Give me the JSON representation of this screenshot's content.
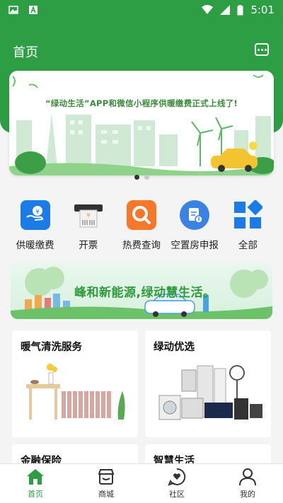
{
  "status_bar": {
    "time": "5:01"
  },
  "header": {
    "title": "首页"
  },
  "banner": {
    "headline": "“绿动生活”APP和微信小程序供暖缴费正式上线了!"
  },
  "services": [
    {
      "label": "供暖缴费",
      "icon": "heating-payment-icon"
    },
    {
      "label": "开票",
      "icon": "invoice-printer-icon"
    },
    {
      "label": "热费查询",
      "icon": "search-icon"
    },
    {
      "label": "空置房申报",
      "icon": "vacant-report-icon"
    },
    {
      "label": "全部",
      "icon": "grid-all-icon"
    }
  ],
  "promo": {
    "slogan": "峰和新能源,绿动慧生活。"
  },
  "cards": [
    {
      "title": "暖气清洗服务"
    },
    {
      "title": "绿动优选"
    },
    {
      "title": "金融保险"
    },
    {
      "title": "智慧生活"
    }
  ],
  "nav": [
    {
      "label": "首页",
      "active": true
    },
    {
      "label": "商城",
      "active": false
    },
    {
      "label": "社区",
      "active": false
    },
    {
      "label": "我的",
      "active": false
    }
  ],
  "colors": {
    "primary": "#2e9e45",
    "service_blue": "#1b7ce8",
    "service_orange": "#f7782a"
  }
}
